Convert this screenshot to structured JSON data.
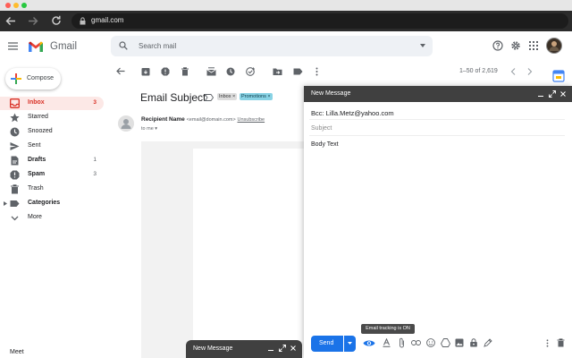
{
  "browser": {
    "url": "gmail.com"
  },
  "header": {
    "app_name": "Gmail",
    "search_placeholder": "Search mail"
  },
  "sidebar": {
    "compose_label": "Compose",
    "items": [
      {
        "label": "Inbox",
        "count": "3",
        "icon": "inbox-icon",
        "active": true,
        "bold": true
      },
      {
        "label": "Starred",
        "count": "",
        "icon": "star-icon"
      },
      {
        "label": "Snoozed",
        "count": "",
        "icon": "clock-icon"
      },
      {
        "label": "Sent",
        "count": "",
        "icon": "send-icon"
      },
      {
        "label": "Drafts",
        "count": "1",
        "icon": "draft-icon",
        "bold": true
      },
      {
        "label": "Spam",
        "count": "3",
        "icon": "spam-icon",
        "bold": true
      },
      {
        "label": "Trash",
        "count": "",
        "icon": "trash-icon"
      },
      {
        "label": "Categories",
        "count": "",
        "icon": "label-icon",
        "bold": true
      },
      {
        "label": "More",
        "count": "",
        "icon": "chevron-down-icon"
      }
    ],
    "meet_label": "Meet"
  },
  "mail_toolbar": {
    "pager": "1–50 of 2,619"
  },
  "email": {
    "subject": "Email Subject",
    "labels": [
      "Inbox ×",
      "Promotions ×"
    ],
    "recipient_name": "Recipient Name",
    "recipient_email": "<email@domain.com>",
    "unsubscribe": "Unsubscribe",
    "to_me": "to me ▾"
  },
  "compose": {
    "title": "New Message",
    "bcc": "Bcc: Lilla.Metz@yahoo.com",
    "subject_placeholder": "Subject",
    "body": "Body Text",
    "send_label": "Send",
    "tracking_tooltip": "Email tracking is ON",
    "tracking_color": "#1a73e8"
  },
  "mini_compose": {
    "title": "New Message"
  },
  "colors": {
    "accent": "#1a73e8",
    "inbox_active_bg": "#fce8e6",
    "inbox_red": "#d93025",
    "promotions_chip": "#89d3e5"
  }
}
